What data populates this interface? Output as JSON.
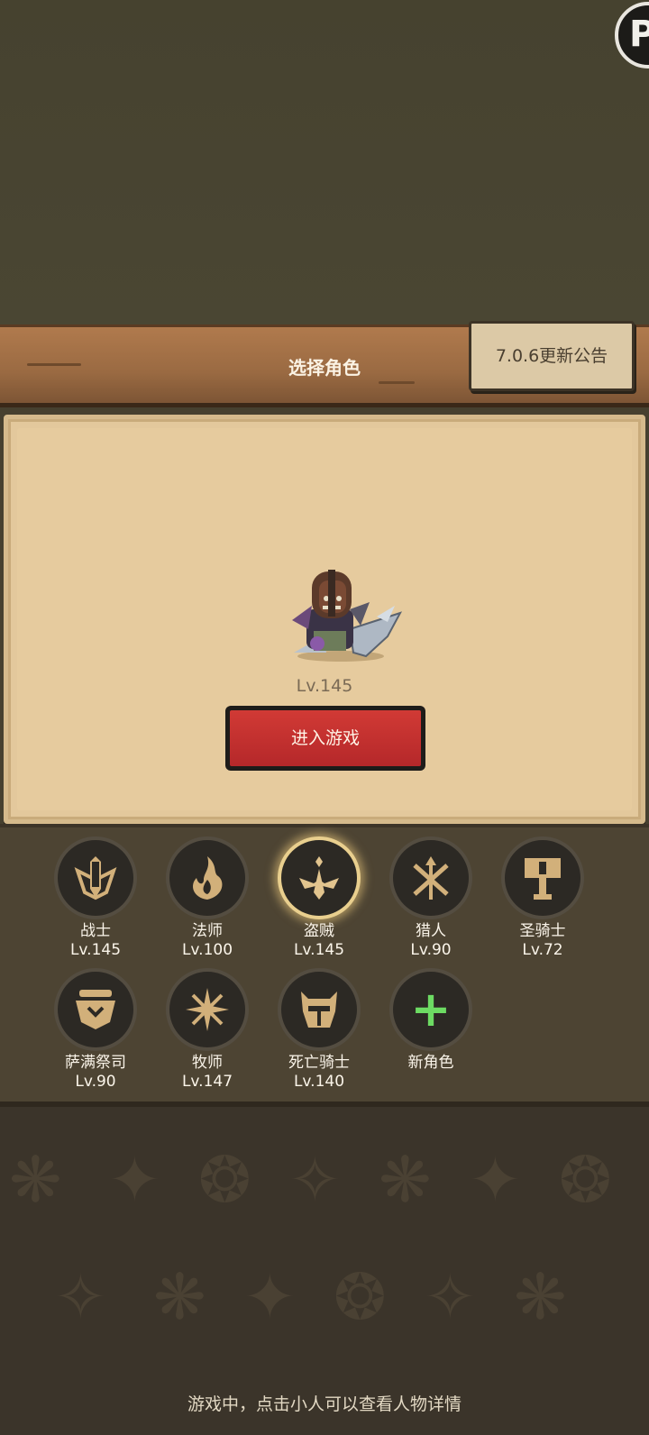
{
  "header": {
    "title": "选择角色",
    "notice_label": "7.0.6更新公告",
    "corner_label": "P"
  },
  "hero": {
    "level": "Lv.145"
  },
  "enter_label": "进入游戏",
  "classes": [
    {
      "name": "战士",
      "level": "Lv.145",
      "icon": "sword-shield-icon"
    },
    {
      "name": "法师",
      "level": "Lv.100",
      "icon": "flame-icon"
    },
    {
      "name": "盗贼",
      "level": "Lv.145",
      "icon": "dagger-icon",
      "selected": true
    },
    {
      "name": "猎人",
      "level": "Lv.90",
      "icon": "crossed-arrows-icon"
    },
    {
      "name": "圣骑士",
      "level": "Lv.72",
      "icon": "hammer-icon"
    },
    {
      "name": "萨满祭司",
      "level": "Lv.90",
      "icon": "totem-icon"
    },
    {
      "name": "牧师",
      "level": "Lv.147",
      "icon": "holy-star-icon"
    },
    {
      "name": "死亡骑士",
      "level": "Lv.140",
      "icon": "helmet-icon"
    }
  ],
  "new_role_label": "新角色",
  "hint": "游戏中，点击小人可以查看人物详情",
  "colors": {
    "enter_button": "#c8302f",
    "plus": "#6ddb63",
    "icon_gold": "#d2b07a",
    "selected_glow": "#e9cf8e"
  }
}
